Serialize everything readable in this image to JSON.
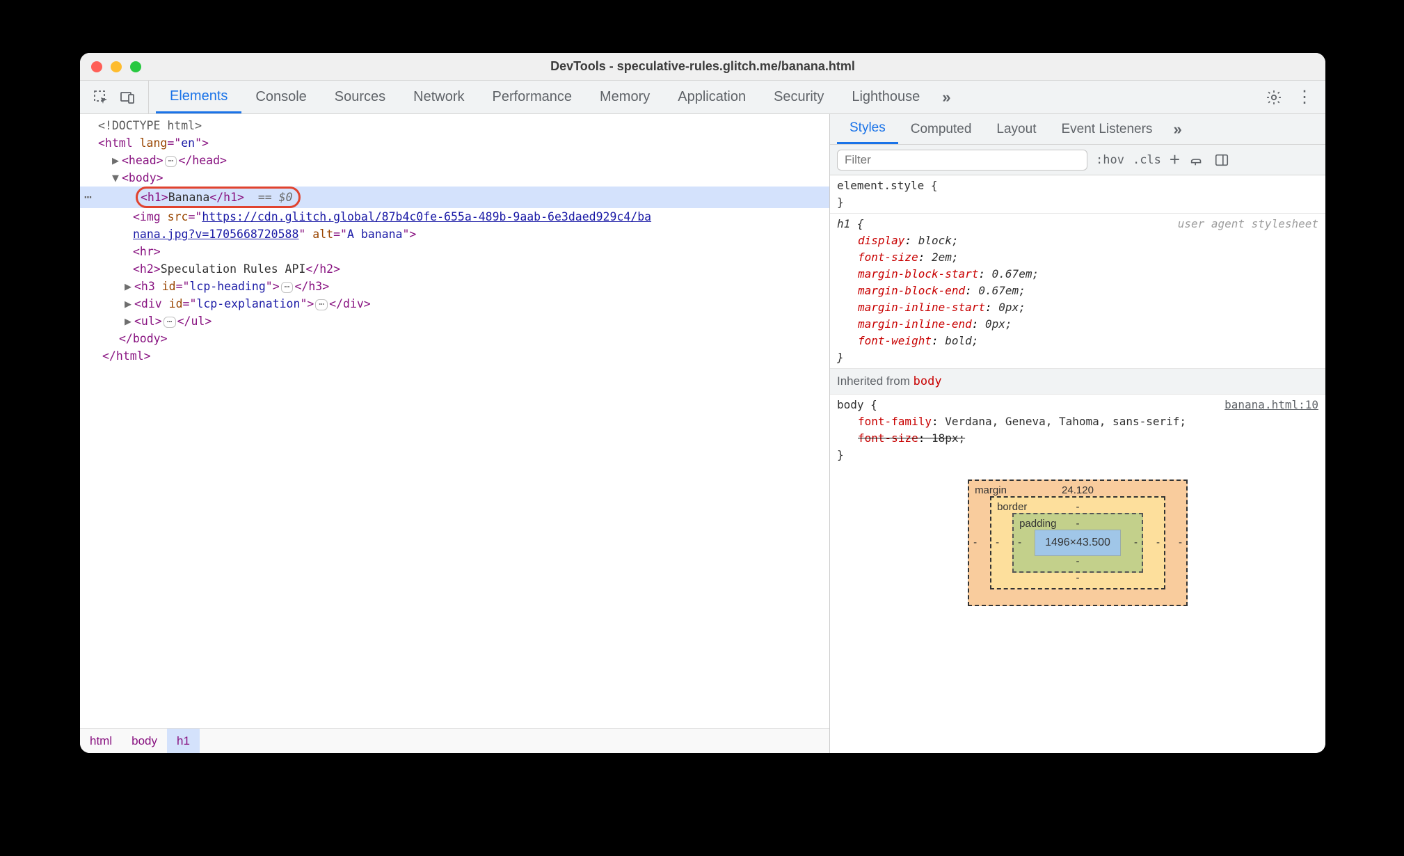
{
  "window": {
    "title": "DevTools - speculative-rules.glitch.me/banana.html"
  },
  "main_tabs": [
    "Elements",
    "Console",
    "Sources",
    "Network",
    "Performance",
    "Memory",
    "Application",
    "Security",
    "Lighthouse"
  ],
  "main_tabs_active_index": 0,
  "dom": {
    "doctype": "<!DOCTYPE html>",
    "html_open": "<html lang=\"en\">",
    "head_collapsed": {
      "open": "<head>",
      "close": "</head>"
    },
    "body_open": "<body>",
    "selected_h1": {
      "markup": "<h1>Banana</h1>",
      "console_ref": "== $0"
    },
    "img_line1_prefix": "<img src=\"",
    "img_url_part1": "https://cdn.glitch.global/87b4c0fe-655a-489b-9aab-6e3daed929c4/ba",
    "img_url_part2": "nana.jpg?v=1705668720588",
    "img_line2_suffix": "\" alt=\"A banana\">",
    "hr": "<hr>",
    "h2": {
      "open": "<h2>",
      "text": "Speculation Rules API",
      "close": "</h2>"
    },
    "h3": {
      "open": "<h3 id=\"lcp-heading\">",
      "close": "</h3>"
    },
    "div": {
      "open": "<div id=\"lcp-explanation\">",
      "close": "</div>"
    },
    "ul": {
      "open": "<ul>",
      "close": "</ul>"
    },
    "body_close": "</body>",
    "html_close": "</html>"
  },
  "breadcrumbs": [
    "html",
    "body",
    "h1"
  ],
  "side_tabs": [
    "Styles",
    "Computed",
    "Layout",
    "Event Listeners"
  ],
  "side_tabs_active_index": 0,
  "styles_toolbar": {
    "filter_placeholder": "Filter",
    "hov": ":hov",
    "cls": ".cls"
  },
  "styles": {
    "element_style": "element.style {",
    "element_style_close": "}",
    "h1_selector": "h1 {",
    "origin_ua": "user agent stylesheet",
    "h1_props": [
      {
        "p": "display",
        "v": "block;"
      },
      {
        "p": "font-size",
        "v": "2em;"
      },
      {
        "p": "margin-block-start",
        "v": "0.67em;"
      },
      {
        "p": "margin-block-end",
        "v": "0.67em;"
      },
      {
        "p": "margin-inline-start",
        "v": "0px;"
      },
      {
        "p": "margin-inline-end",
        "v": "0px;"
      },
      {
        "p": "font-weight",
        "v": "bold;"
      }
    ],
    "h1_close": "}",
    "inherited_label_prefix": "Inherited from ",
    "inherited_label_body": "body",
    "body_selector": "body {",
    "body_link": "banana.html:10",
    "body_props": [
      {
        "p": "font-family",
        "v": "Verdana, Geneva, Tahoma, sans-serif;",
        "struck": false
      },
      {
        "p": "font-size",
        "v": "18px;",
        "struck": true
      }
    ],
    "body_close": "}"
  },
  "boxmodel": {
    "margin_label": "margin",
    "margin_top": "24.120",
    "border_label": "border",
    "border_val": "-",
    "padding_label": "padding",
    "padding_val": "-",
    "content": "1496×43.500",
    "dash": "-"
  }
}
